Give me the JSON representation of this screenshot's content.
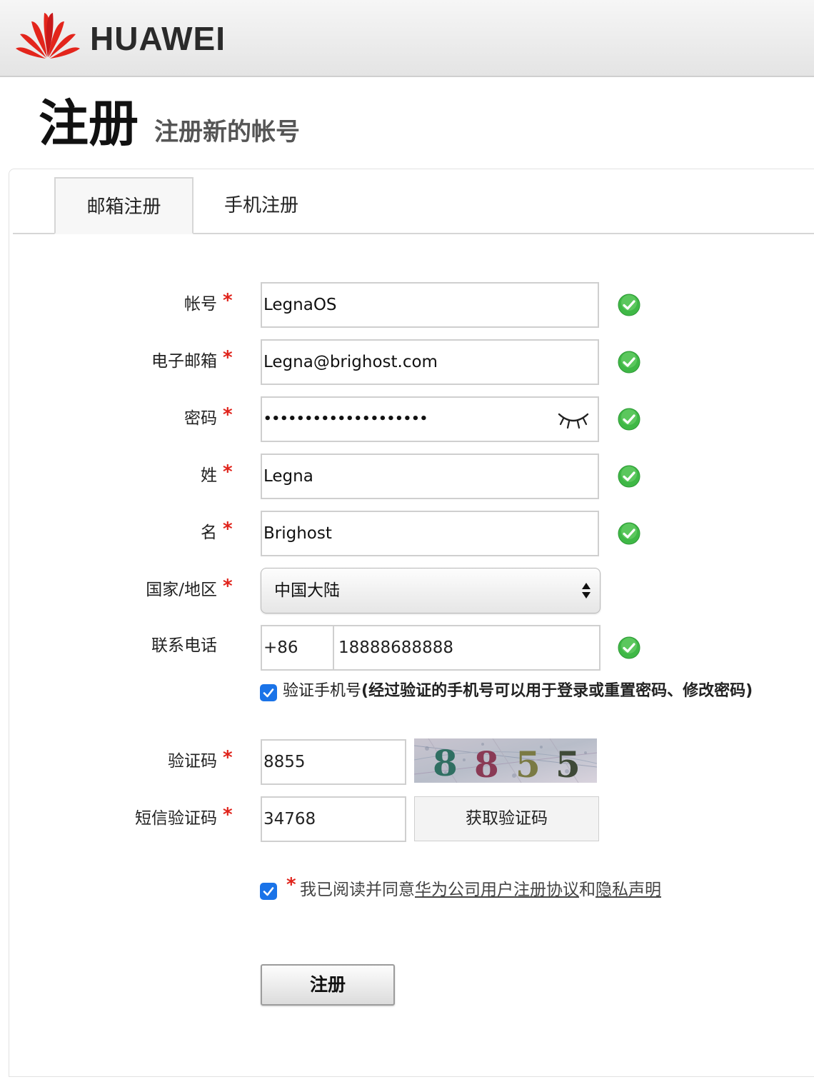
{
  "header": {
    "brand": "HUAWEI"
  },
  "page": {
    "title": "注册",
    "subtitle": "注册新的帐号"
  },
  "tabs": [
    {
      "label": "邮箱注册",
      "active": true
    },
    {
      "label": "手机注册",
      "active": false
    }
  ],
  "form": {
    "account": {
      "label": "帐号",
      "required": "*",
      "value": "LegnaOS",
      "valid": true
    },
    "email": {
      "label": "电子邮箱",
      "required": "*",
      "value": "Legna@brighost.com",
      "valid": true
    },
    "password": {
      "label": "密码",
      "required": "*",
      "value": "••••••••••••••••••••",
      "valid": true,
      "toggle_icon": "eye-closed-icon"
    },
    "last_name": {
      "label": "姓",
      "required": "*",
      "value": "Legna",
      "valid": true
    },
    "first_name": {
      "label": "名",
      "required": "*",
      "value": "Brighost",
      "valid": true
    },
    "country": {
      "label": "国家/地区",
      "required": "*",
      "selected": "中国大陆"
    },
    "phone": {
      "label": "联系电话",
      "country_code": "+86",
      "number": "18888688888",
      "valid": true
    },
    "verify_phone": {
      "checked": true,
      "text_prefix": "验证手机号",
      "text_note": "(经过验证的手机号可以用于登录或重置密码、修改密码)"
    },
    "captcha": {
      "label": "验证码",
      "required": "*",
      "value": "8855",
      "image_text": "8855"
    },
    "sms_code": {
      "label": "短信验证码",
      "required": "*",
      "value": "34768",
      "button": "获取验证码"
    },
    "agreement": {
      "checked": true,
      "required": "*",
      "prefix": "我已阅读并同意",
      "link1": "华为公司用户注册协议",
      "and": "和",
      "link2": "隐私声明"
    },
    "submit": "注册"
  },
  "colors": {
    "required_star": "#e0231b",
    "checkbox": "#1a73e8",
    "valid_green": "#3fb846"
  }
}
